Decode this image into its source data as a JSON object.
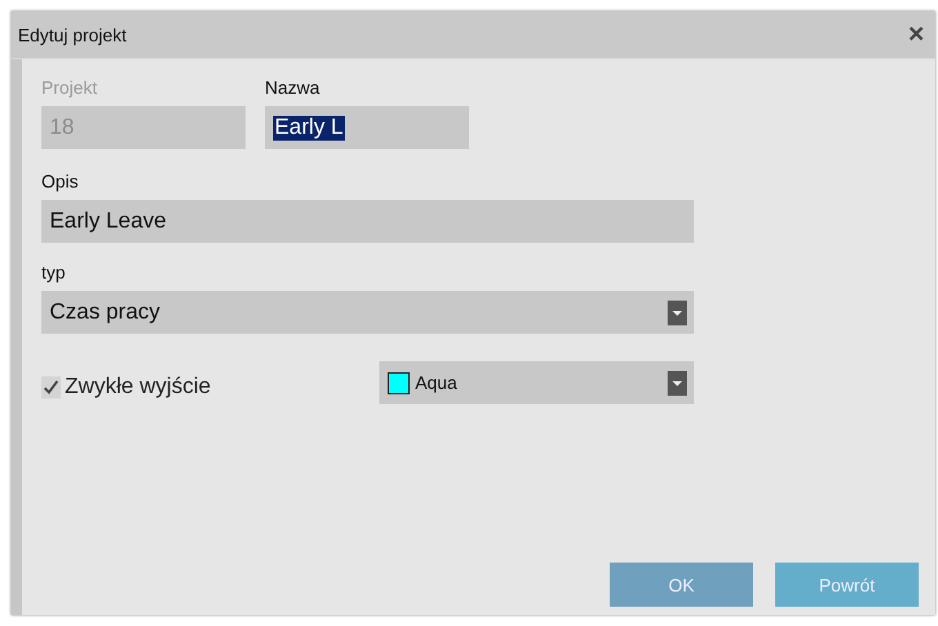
{
  "window": {
    "title": "Edytuj projekt",
    "close": "×"
  },
  "project": {
    "label": "Projekt",
    "value": "18",
    "disabled": true
  },
  "name": {
    "label": "Nazwa",
    "value": "Early L",
    "text_selected": true
  },
  "description": {
    "label": "Opis",
    "value": "Early Leave"
  },
  "type": {
    "label": "typ",
    "value": "Czas pracy"
  },
  "usual_exit": {
    "label": "Zwykłe wyjście",
    "checked": true
  },
  "color_select": {
    "value": "Aqua",
    "color": "#00ffff"
  },
  "buttons": [
    {
      "label": "OK",
      "kind": "primary"
    },
    {
      "label": "Powrót",
      "kind": "secondary"
    }
  ]
}
